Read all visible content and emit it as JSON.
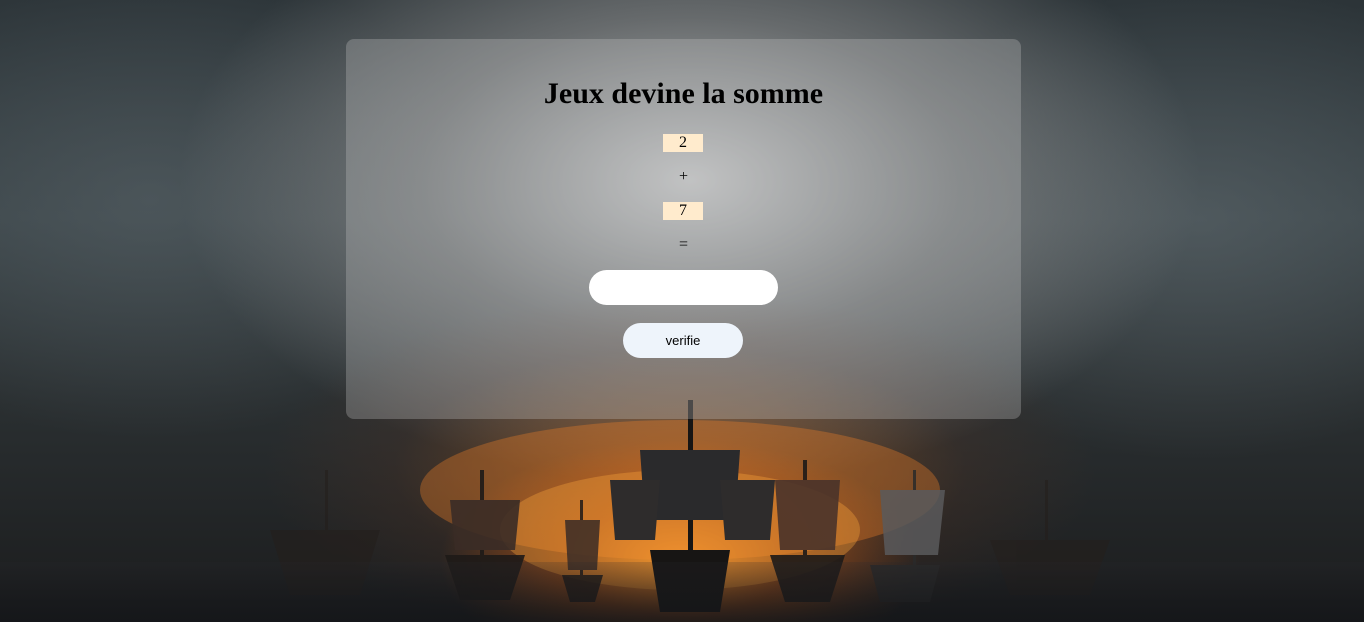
{
  "game": {
    "title": "Jeux devine la somme",
    "first_number": "2",
    "operator": "+",
    "second_number": "7",
    "equals": "=",
    "answer_value": "",
    "verify_label": "verifie"
  },
  "colors": {
    "number_box_bg": "#ffebcd",
    "panel_bg": "rgba(200,200,200,0.30)",
    "button_bg": "#eef4fb",
    "input_bg": "#ffffff"
  }
}
